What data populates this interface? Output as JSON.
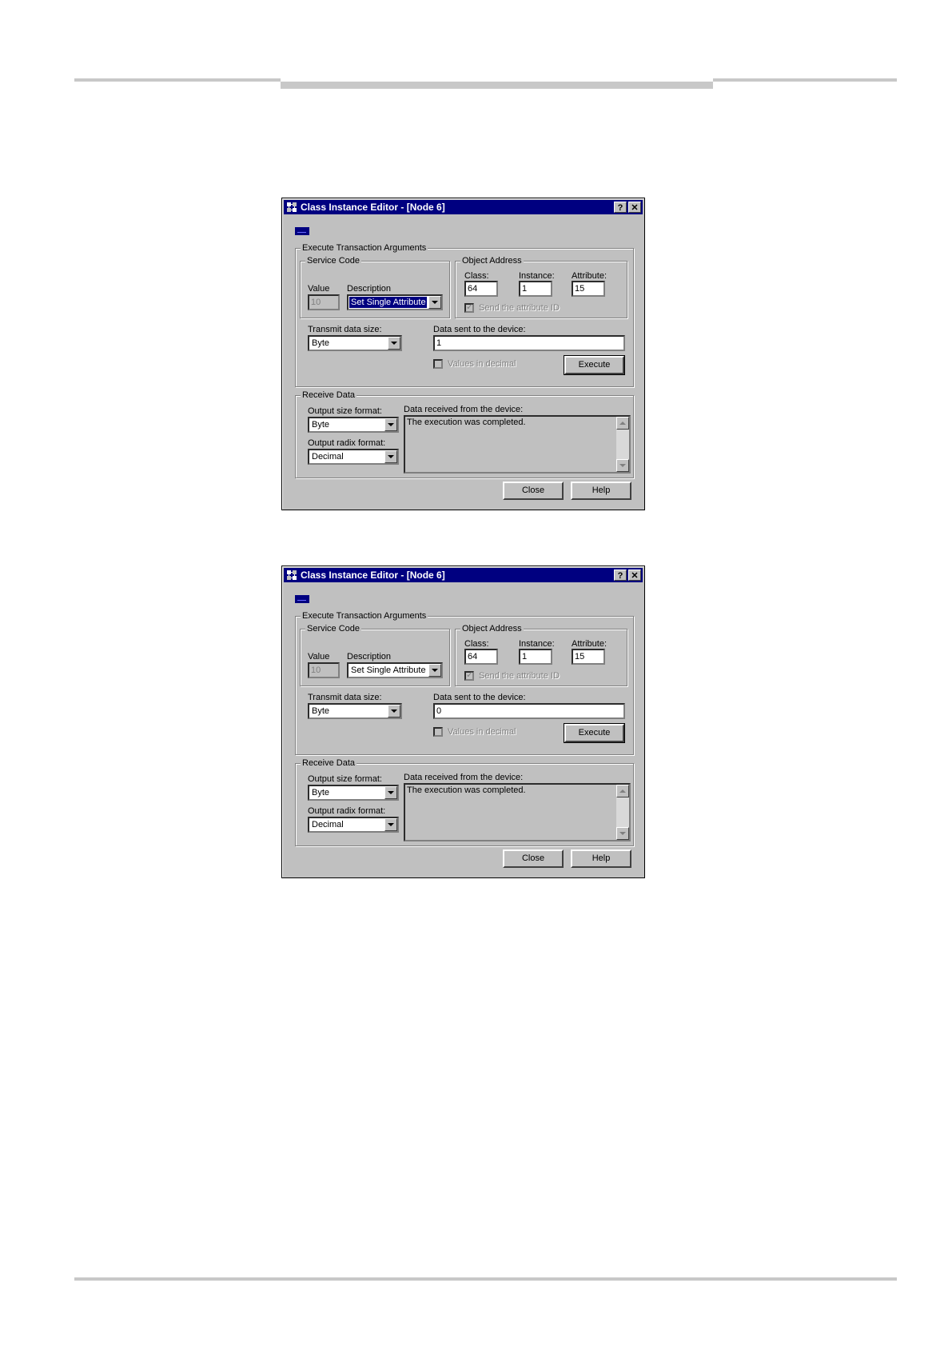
{
  "dialogs": [
    {
      "title": "Class Instance Editor - [Node 6]",
      "title_buttons": {
        "help": "?",
        "close": "✕"
      },
      "execute_group": "Execute Transaction Arguments",
      "service_code": {
        "group": "Service Code",
        "value_label": "Value",
        "value": "10",
        "description_label": "Description",
        "description": "Set Single Attribute",
        "description_highlighted": true
      },
      "object_address": {
        "group": "Object Address",
        "class_label": "Class:",
        "class": "64",
        "instance_label": "Instance:",
        "instance": "1",
        "attribute_label": "Attribute:",
        "attribute": "15",
        "send_attr_label": "Send the attribute ID",
        "send_attr_checked": true
      },
      "transmit": {
        "size_label": "Transmit data size:",
        "size": "Byte",
        "data_label": "Data sent to the device:",
        "data": "1",
        "decimal_label": "Values in decimal",
        "decimal_checked": false,
        "execute_label": "Execute"
      },
      "receive": {
        "group": "Receive Data",
        "output_size_label": "Output size format:",
        "output_size": "Byte",
        "output_radix_label": "Output radix format:",
        "output_radix": "Decimal",
        "received_label": "Data received from the device:",
        "received_text": "The execution was completed."
      },
      "buttons": {
        "close": "Close",
        "help": "Help"
      }
    },
    {
      "title": "Class Instance Editor - [Node 6]",
      "title_buttons": {
        "help": "?",
        "close": "✕"
      },
      "execute_group": "Execute Transaction Arguments",
      "service_code": {
        "group": "Service Code",
        "value_label": "Value",
        "value": "10",
        "description_label": "Description",
        "description": "Set Single Attribute",
        "description_highlighted": false
      },
      "object_address": {
        "group": "Object Address",
        "class_label": "Class:",
        "class": "64",
        "instance_label": "Instance:",
        "instance": "1",
        "attribute_label": "Attribute:",
        "attribute": "15",
        "send_attr_label": "Send the attribute ID",
        "send_attr_checked": true
      },
      "transmit": {
        "size_label": "Transmit data size:",
        "size": "Byte",
        "data_label": "Data sent to the device:",
        "data": "0",
        "decimal_label": "Values in decimal",
        "decimal_checked": false,
        "execute_label": "Execute"
      },
      "receive": {
        "group": "Receive Data",
        "output_size_label": "Output size format:",
        "output_size": "Byte",
        "output_radix_label": "Output radix format:",
        "output_radix": "Decimal",
        "received_label": "Data received from the device:",
        "received_text": "The execution was completed."
      },
      "buttons": {
        "close": "Close",
        "help": "Help"
      }
    }
  ]
}
